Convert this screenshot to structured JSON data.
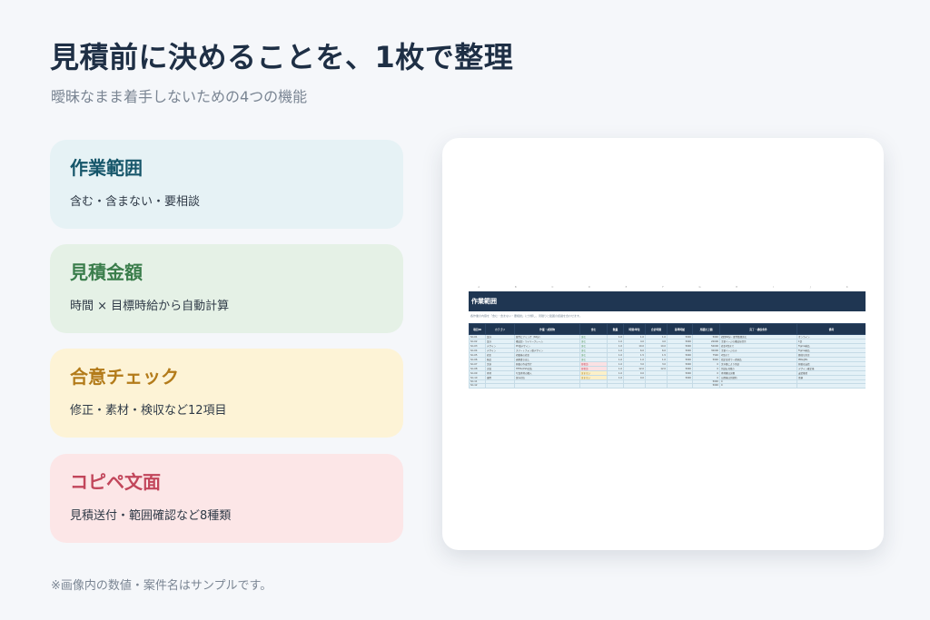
{
  "header": {
    "title": "見積前に決めることを、1枚で整理",
    "subtitle": "曖昧なまま着手しないための4つの機能"
  },
  "cards": [
    {
      "title": "作業範囲",
      "desc": "含む・含まない・要相談"
    },
    {
      "title": "見積金額",
      "desc": "時間 × 目標時給から自動計算"
    },
    {
      "title": "合意チェック",
      "desc": "修正・素材・検収など12項目"
    },
    {
      "title": "コピペ文面",
      "desc": "見積送付・範囲確認など8種類"
    }
  ],
  "footnote": "※画像内の数値・案件名はサンプルです。",
  "sheet": {
    "columns": [
      "A",
      "B",
      "C",
      "D",
      "E",
      "F",
      "G",
      "H",
      "I",
      "J",
      "K"
    ],
    "title": "作業範囲",
    "note": "各作業の内容を「含む・含まない・要相談」に分類し、見積りと範囲の認識を合わせます。",
    "headers": [
      "項目ID",
      "カテゴリ",
      "作業・成果物",
      "含む",
      "数量",
      "時間/単位",
      "合計時間",
      "基準時給",
      "見積計上額",
      "完了・検収条件",
      "備考"
    ],
    "rows": [
      [
        "SC-01",
        "設計",
        "要件ヒアリング（60分）",
        "含む",
        "1.0",
        "1.0",
        "1.0",
        "5000",
        "5000",
        "初回60分・要件整理含む",
        "オンライン"
      ],
      [
        "SC-02",
        "設計",
        "構成案・ワイヤーフレーム",
        "含む",
        "1.0",
        "4.0",
        "4.0",
        "5000",
        "20000",
        "主要ページの構成を提示",
        "1案"
      ],
      [
        "SC-03",
        "デザイン",
        "PC版デザイン",
        "含む",
        "1.0",
        "10.0",
        "10.0",
        "5000",
        "50000",
        "修正2回まで",
        "Figma納品"
      ],
      [
        "SC-04",
        "デザイン",
        "スマートフォン版デザイン",
        "含む",
        "1.0",
        "6.0",
        "6.0",
        "5000",
        "30000",
        "主要ページのみ",
        "Figma納品"
      ],
      [
        "SC-05",
        "修正",
        "初稿後の修正",
        "含む",
        "1.0",
        "1.5",
        "1.5",
        "5000",
        "7500",
        "2回まで",
        "軽微な修正"
      ],
      [
        "SC-06",
        "納品",
        "画像書き出し",
        "含む",
        "1.0",
        "1.0",
        "1.0",
        "5000",
        "5000",
        "指定形式で一式納品",
        "PNG/JPG"
      ],
      [
        "SC-07",
        "文章",
        "原稿の作成代行",
        "要相談",
        "1.0",
        "3.0",
        "3.0",
        "5000",
        "0",
        "文字数により別途",
        "原稿は支給"
      ],
      [
        "SC-08",
        "実装",
        "HTML/CSS実装",
        "要相談",
        "1.0",
        "12.0",
        "12.0",
        "5000",
        "0",
        "別途お見積り",
        "デザイン確定後"
      ],
      [
        "SC-09",
        "素材",
        "写真素材の購入",
        "含まない",
        "1.0",
        "0.0",
        "",
        "5000",
        "0",
        "素材費は実費",
        "支給推奨"
      ],
      [
        "SC-10",
        "運用",
        "保守対応",
        "含まない",
        "1.0",
        "0.0",
        "",
        "5000",
        "0",
        "公開後は別契約",
        "月額"
      ],
      [
        "SC-11",
        "",
        "",
        "",
        "",
        "",
        "",
        "",
        "5000",
        "0",
        ""
      ],
      [
        "SC-12",
        "",
        "",
        "",
        "",
        "",
        "",
        "",
        "5000",
        "0",
        ""
      ]
    ]
  }
}
